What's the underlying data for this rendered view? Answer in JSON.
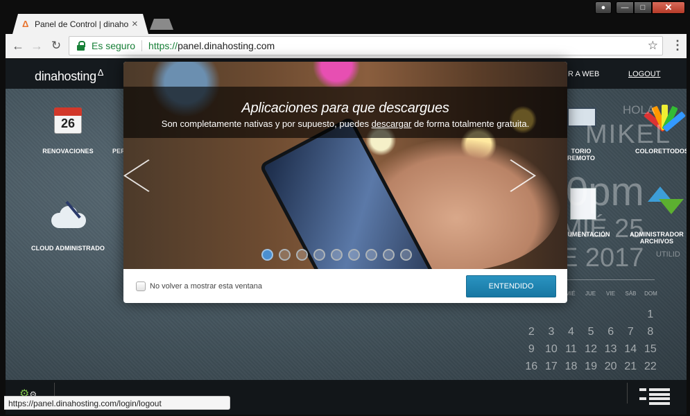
{
  "browser": {
    "tab_title": "Panel de Control | dinahosting",
    "tab_close": "×",
    "secure_label": "Es seguro",
    "url_scheme": "https://",
    "url_host": "panel.dinahosting.com",
    "status_url": "https://panel.dinahosting.com/login/logout"
  },
  "header": {
    "logo": "dinahosting",
    "logo_mark": "Δ",
    "nav_ir": "IR A WEB",
    "nav_logout": "LOGOUT"
  },
  "tiles": {
    "renovaciones": "RENOVACIONES",
    "renovaciones_day": "26",
    "per": "PER",
    "cloud": "CLOUD ADMINISTRADO",
    "remote": "TORIO REMOTO",
    "colorettodos": "COLORETTODOS",
    "documentacion": "UMENTACIÓN",
    "admin_archivos": "ADMINISTRADOR ARCHIVOS"
  },
  "welcome": {
    "hola": "HOLA",
    "user": "MIKEL",
    "time": "0pm",
    "date": "MIÉ 25",
    "year": "E 2017",
    "util": "UTILID"
  },
  "calendar": {
    "weekdays": [
      "MIÉ",
      "JUE",
      "VIE",
      "SÁB",
      "DOM"
    ],
    "rows": [
      [
        "",
        "",
        "",
        "",
        "",
        "",
        "1"
      ],
      [
        "2",
        "3",
        "4",
        "5",
        "6",
        "7",
        "8"
      ],
      [
        "9",
        "10",
        "11",
        "12",
        "13",
        "14",
        "15"
      ],
      [
        "16",
        "17",
        "18",
        "19",
        "20",
        "21",
        "22"
      ]
    ]
  },
  "modal": {
    "title": "Aplicaciones para que descargues",
    "subtitle_pre": "Son completamente nativas y por supuesto, puedes ",
    "subtitle_link": "descargar",
    "subtitle_post": " de forma totalmente gratuita.",
    "checkbox_label": "No volver a mostrar esta ventana",
    "ok_button": "ENTENDIDO",
    "slide_count": 9,
    "active_slide": 0
  },
  "colors": {
    "accent": "#1a80ad",
    "secure_green": "#188038",
    "topbar": "#151a1e",
    "active_dot": "#4a8fd0"
  },
  "icons": [
    "user-icon",
    "minimize-icon",
    "maximize-icon",
    "close-icon",
    "back-icon",
    "forward-icon",
    "reload-icon",
    "lock-icon",
    "star-icon",
    "menu-icon",
    "calendar-icon",
    "cloud-icon",
    "monitor-icon",
    "palette-icon",
    "document-icon",
    "arrows-icon",
    "gears-icon",
    "list-icon"
  ]
}
